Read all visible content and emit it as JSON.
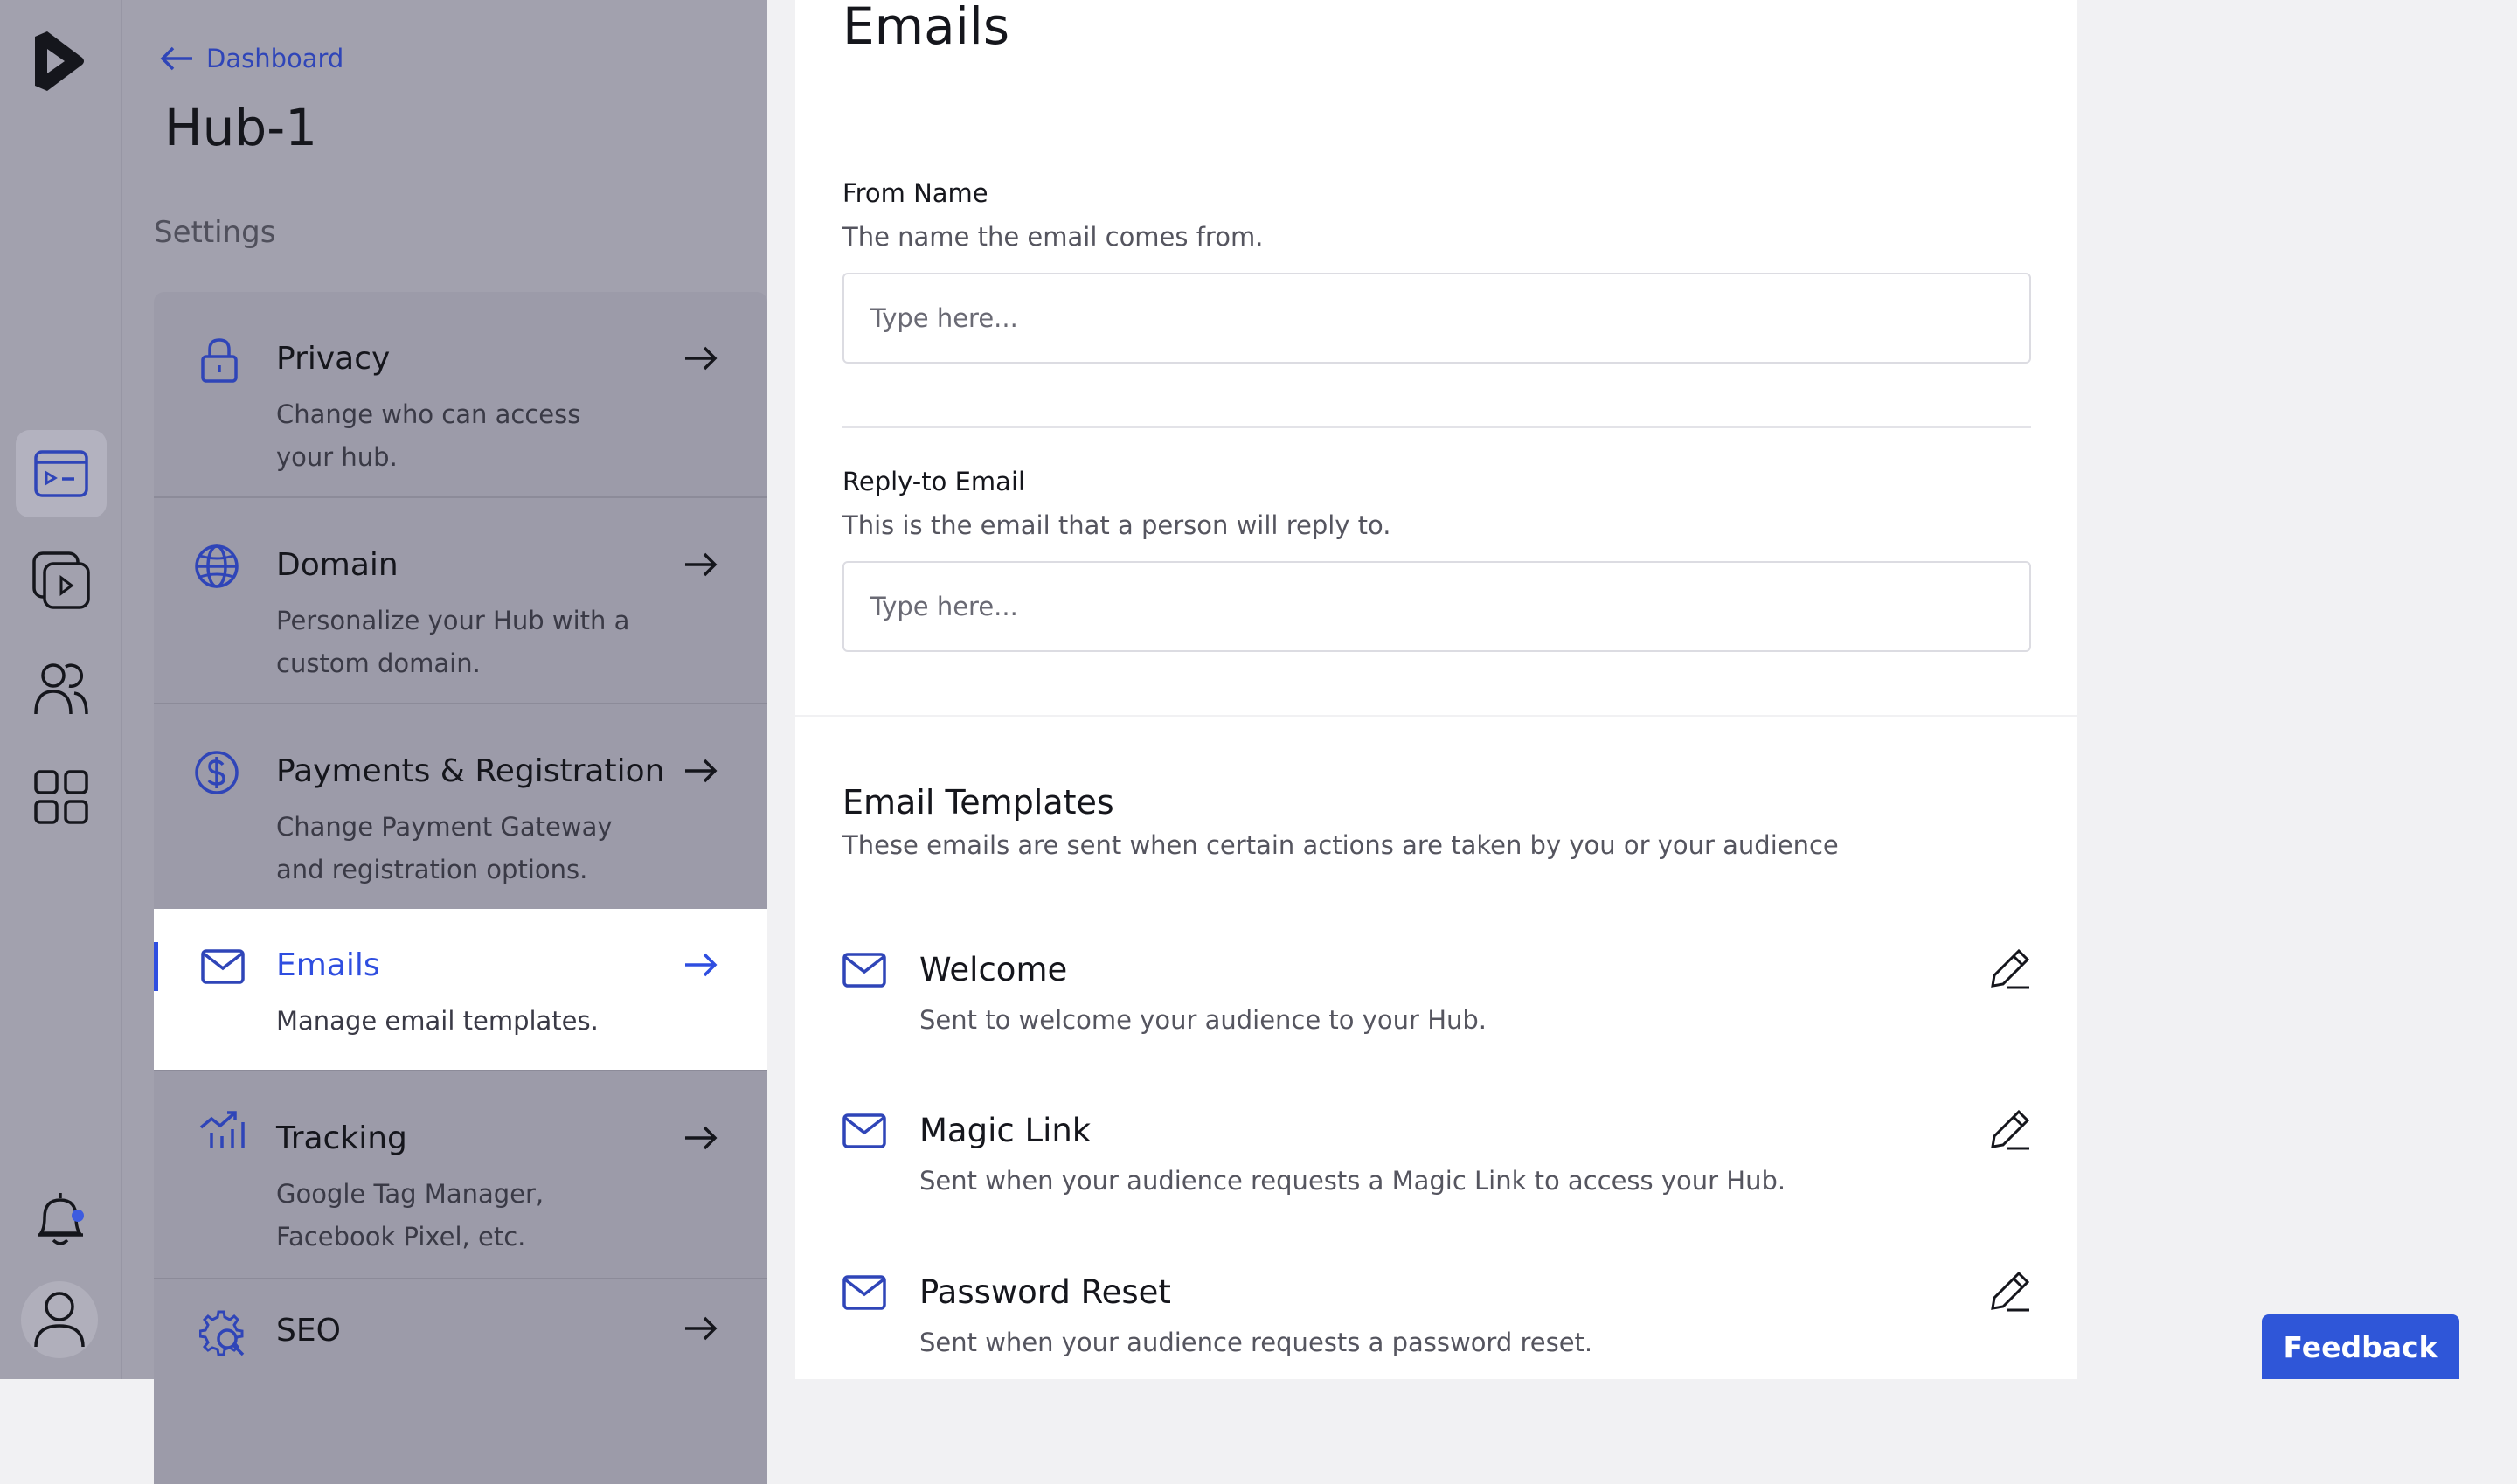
{
  "nav": {
    "back_label": "Dashboard",
    "hub_title": "Hub-1",
    "settings_label": "Settings"
  },
  "rail": {
    "icons": [
      "brand-logo-icon",
      "hubs-icon",
      "videos-icon",
      "people-icon",
      "apps-grid-icon",
      "bell-icon",
      "avatar-icon"
    ],
    "active": "hubs-icon",
    "notification_dot_color": "#3d5ce0"
  },
  "menu": {
    "items": [
      {
        "title": "Privacy",
        "desc": "Change who can access your hub.",
        "icon": "lock-icon"
      },
      {
        "title": "Domain",
        "desc": "Personalize your Hub with a custom domain.",
        "icon": "globe-icon"
      },
      {
        "title": "Payments & Registration",
        "desc": "Change Payment Gateway and registration options.",
        "icon": "dollar-icon"
      },
      {
        "title": "Emails",
        "desc": "Manage email templates.",
        "icon": "mail-icon",
        "active": true
      },
      {
        "title": "Tracking",
        "desc": "Google Tag Manager, Facebook Pixel, etc.",
        "icon": "chart-up-icon"
      },
      {
        "title": "SEO",
        "desc": "",
        "icon": "gear-search-icon"
      }
    ]
  },
  "main": {
    "title": "Emails",
    "from_name": {
      "label": "From Name",
      "help": "The name the email comes from.",
      "placeholder": "Type here...",
      "value": ""
    },
    "reply_to": {
      "label": "Reply-to Email",
      "help": "This is the email that a person will reply to.",
      "placeholder": "Type here...",
      "value": ""
    },
    "templates": {
      "title": "Email Templates",
      "help": "These emails are sent when certain actions are taken by you or your audience",
      "items": [
        {
          "name": "Welcome",
          "desc": "Sent to welcome your audience to your Hub."
        },
        {
          "name": "Magic Link",
          "desc": "Sent when your audience requests a Magic Link to access your Hub."
        },
        {
          "name": "Password Reset",
          "desc": "Sent when your audience requests a password reset."
        }
      ]
    }
  },
  "feedback_label": "Feedback",
  "colors": {
    "accent": "#2f4ee0",
    "feedback": "#2f56d8",
    "overlay": "#a2a1ae"
  }
}
